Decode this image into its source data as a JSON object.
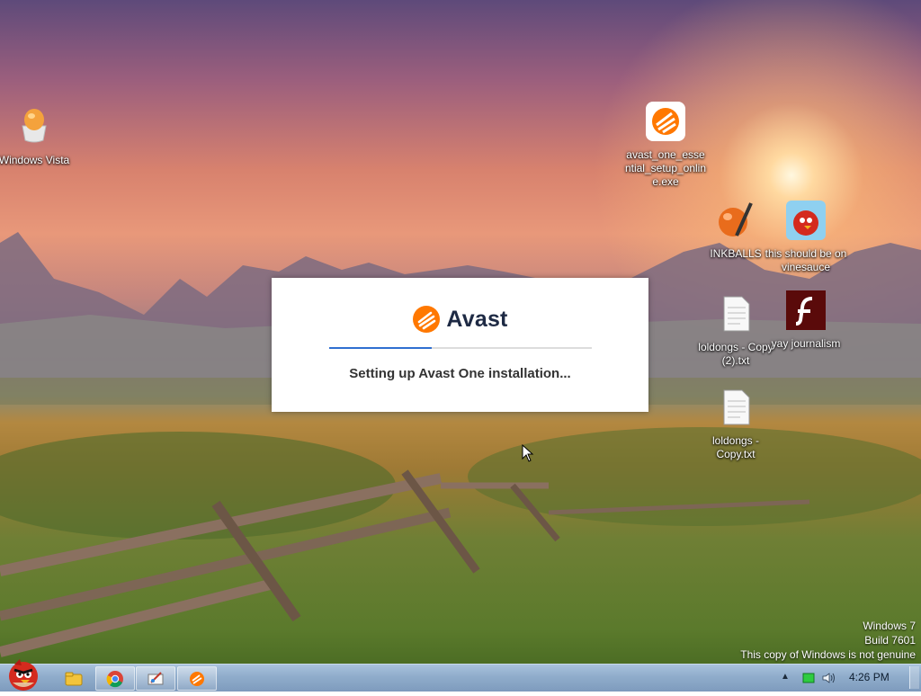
{
  "desktop": {
    "icons": [
      {
        "label": "Windows Vista",
        "icon": "egg-icon"
      },
      {
        "label": "avast_one_essential_setup_online.exe",
        "icon": "avast-installer-icon"
      },
      {
        "label": "INKBALLS",
        "icon": "inkball-icon"
      },
      {
        "label": "this should be on vinesauce",
        "icon": "angry-bird-icon"
      },
      {
        "label": "loldongs - Copy (2).txt",
        "icon": "text-file-icon"
      },
      {
        "label": "yay journalism",
        "icon": "flash-icon"
      },
      {
        "label": "loldongs - Copy.txt",
        "icon": "text-file-icon"
      }
    ]
  },
  "dialog": {
    "brand": "Avast",
    "status": "Setting up Avast One installation...",
    "progress": 0.39,
    "accent": "#2f6fd0",
    "brand_color": "#ff7800"
  },
  "watermark": {
    "line1": "Windows 7",
    "line2": "Build 7601",
    "line3": "This copy of Windows is not genuine"
  },
  "taskbar": {
    "start_icon": "angry-bird-icon",
    "pinned": [
      "explorer-icon",
      "chrome-icon",
      "paint-icon",
      "avast-icon"
    ],
    "tray": [
      "show-hidden-icons",
      "network-icon",
      "volume-icon"
    ],
    "clock": "4:26 PM"
  }
}
